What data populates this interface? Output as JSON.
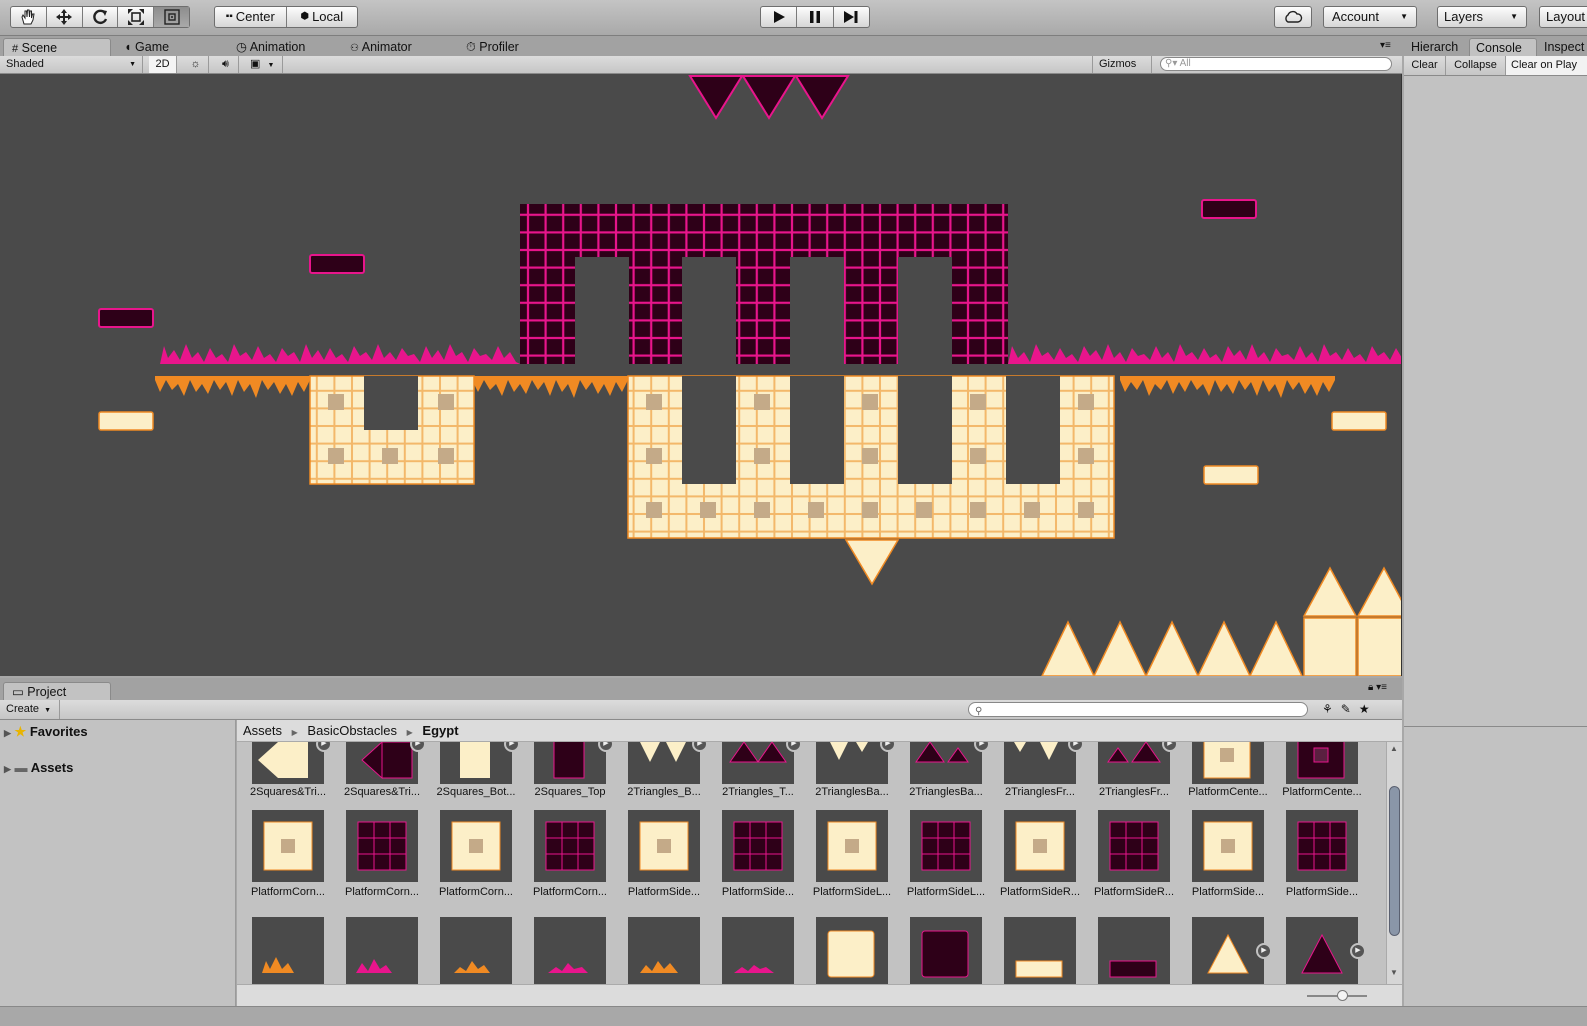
{
  "toolbar": {
    "transform_tools": [
      "hand-tool",
      "move-tool",
      "rotate-tool",
      "scale-tool",
      "rect-tool"
    ],
    "pivot_label": "Center",
    "space_label": "Local",
    "play_controls": [
      "play",
      "pause",
      "step"
    ],
    "account_label": "Account",
    "layers_label": "Layers",
    "layout_label": "Layout"
  },
  "tabs": {
    "scene": "Scene",
    "game": "Game",
    "animation": "Animation",
    "animator": "Animator",
    "profiler": "Profiler"
  },
  "scene_toolbar": {
    "shading": "Shaded",
    "mode_2d": "2D",
    "gizmos": "Gizmos",
    "search_placeholder": "All"
  },
  "right_panel": {
    "tabs": [
      "Hierarch",
      "Console",
      "Inspect"
    ],
    "active_tab": "Console",
    "buttons": [
      "Clear",
      "Collapse",
      "Clear on Play"
    ]
  },
  "project": {
    "tab_label": "Project",
    "create_label": "Create",
    "favorites_label": "Favorites",
    "assets_label": "Assets",
    "breadcrumb": [
      "Assets",
      "BasicObstacles",
      "Egypt"
    ],
    "row1": [
      "2Squares&Tri...",
      "2Squares&Tri...",
      "2Squares_Bot...",
      "2Squares_Top",
      "2Triangles_B...",
      "2Triangles_T...",
      "2TrianglesBa...",
      "2TrianglesBa...",
      "2TrianglesFr...",
      "2TrianglesFr...",
      "PlatformCente...",
      "PlatformCente..."
    ],
    "row2": [
      "PlatformCorn...",
      "PlatformCorn...",
      "PlatformCorn...",
      "PlatformCorn...",
      "PlatformSide...",
      "PlatformSide...",
      "PlatformSideL...",
      "PlatformSideL...",
      "PlatformSideR...",
      "PlatformSideR...",
      "PlatformSide...",
      "PlatformSide..."
    ]
  },
  "colors": {
    "pink": "#e8158c",
    "dark_tile": "#2e0018",
    "cream": "#fcefc8",
    "orange": "#f08a23",
    "viewport_bg": "#4a4a4a"
  }
}
